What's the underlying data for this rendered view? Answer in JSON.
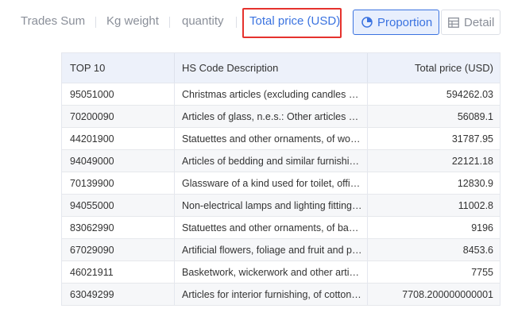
{
  "tabs": {
    "trades_sum": "Trades Sum",
    "kg_weight": "Kg weight",
    "quantity": "quantity",
    "total_price": "Total price (USD)"
  },
  "view_buttons": {
    "proportion": "Proportion",
    "detail": "Detail"
  },
  "colors": {
    "accent": "#3b73e0",
    "highlight_box": "#e5322d",
    "header_bg": "#edf1fa"
  },
  "table": {
    "headers": [
      "TOP 10",
      "HS Code Description",
      "Total price (USD)"
    ],
    "rows": [
      {
        "code": "95051000",
        "desc": "Christmas articles (excluding candles and ...",
        "price": "594262.03"
      },
      {
        "code": "70200090",
        "desc": "Articles of glass, n.e.s.: Other articles of ...",
        "price": "56089.1"
      },
      {
        "code": "44201900",
        "desc": "Statuettes and other ornaments, of wood ...",
        "price": "31787.95"
      },
      {
        "code": "94049000",
        "desc": "Articles of bedding and similar furnishing ...",
        "price": "22121.18"
      },
      {
        "code": "70139900",
        "desc": "Glassware of a kind used for toilet, office ...",
        "price": "12830.9"
      },
      {
        "code": "94055000",
        "desc": "Non-electrical lamps and lighting fittings ...",
        "price": "11002.8"
      },
      {
        "code": "83062990",
        "desc": "Statuettes and other ornaments, of base ...",
        "price": "9196"
      },
      {
        "code": "67029090",
        "desc": "Artificial flowers, foliage and fruit and parts ...",
        "price": "8453.6"
      },
      {
        "code": "46021911",
        "desc": "Basketwork, wickerwork and other articles ...",
        "price": "7755"
      },
      {
        "code": "63049299",
        "desc": "Articles for interior furnishing, of cotton (...",
        "price": "7708.200000000001"
      }
    ]
  }
}
